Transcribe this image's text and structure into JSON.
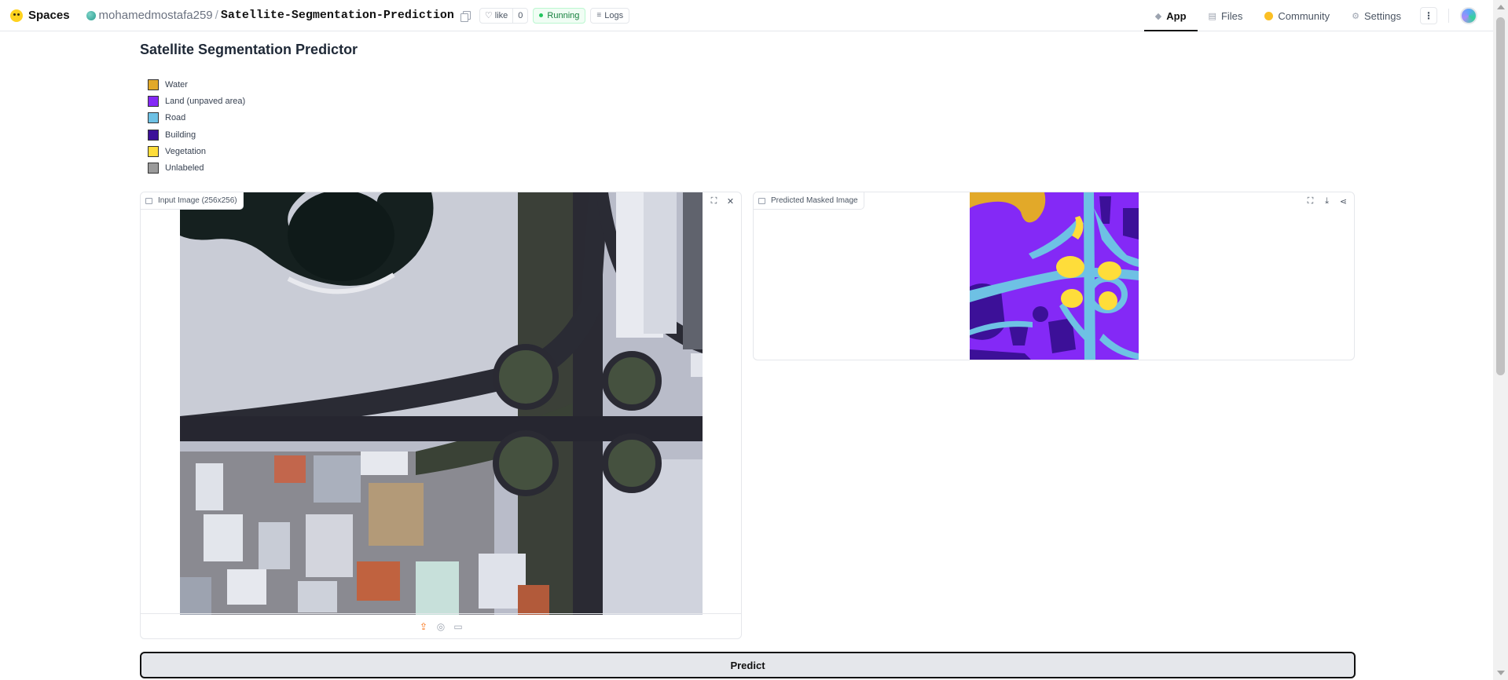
{
  "header": {
    "brand": "Spaces",
    "owner": "mohamedmostafa259",
    "separator": "/",
    "repo": "Satellite-Segmentation-Prediction",
    "like_label": "like",
    "like_count": "0",
    "status": "Running",
    "logs_label": "Logs",
    "nav": {
      "app": "App",
      "files": "Files",
      "community": "Community",
      "settings": "Settings"
    }
  },
  "main": {
    "title": "Satellite Segmentation Predictor",
    "legend": [
      {
        "label": "Water",
        "color": "#E2A929"
      },
      {
        "label": "Land (unpaved area)",
        "color": "#8429F6"
      },
      {
        "label": "Road",
        "color": "#6EC1E4"
      },
      {
        "label": "Building",
        "color": "#3C1098"
      },
      {
        "label": "Vegetation",
        "color": "#FEDD3A"
      },
      {
        "label": "Unlabeled",
        "color": "#9B9B9B"
      }
    ],
    "input_panel": {
      "label": "Input Image (256x256)"
    },
    "output_panel": {
      "label": "Predicted Masked Image"
    },
    "predict_label": "Predict"
  }
}
